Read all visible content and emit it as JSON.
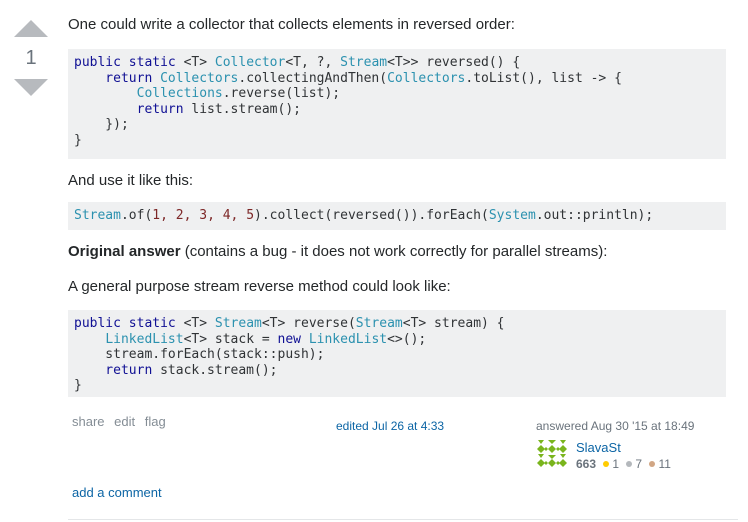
{
  "vote": {
    "count": "1"
  },
  "post": {
    "intro": "One could write a collector that collects elements in reversed order:",
    "usage_intro": "And use it like this:",
    "original_bold": "Original answer",
    "original_rest": " (contains a bug - it does not work correctly for parallel streams):",
    "general_intro": "A general purpose stream reverse method could look like:"
  },
  "code1": {
    "l1a": "public static ",
    "l1b": "<T> ",
    "l1c": "Collector",
    "l1d": "<T, ?, ",
    "l1e": "Stream",
    "l1f": "<T>> reversed() {",
    "l2a": "    return ",
    "l2b": "Collectors",
    "l2c": ".collectingAndThen(",
    "l2d": "Collectors",
    "l2e": ".toList(), list -> {",
    "l3a": "        ",
    "l3b": "Collections",
    "l3c": ".reverse(list);",
    "l4a": "        return ",
    "l4b": "list.stream();",
    "l5": "    });",
    "l6": "}"
  },
  "code2": {
    "a": "Stream",
    "b": ".of(",
    "c": "1, 2, 3, 4, 5",
    "d": ").collect(reversed()).forEach(",
    "e": "System",
    "f": ".out::println);"
  },
  "code3": {
    "l1a": "public static ",
    "l1b": "<T> ",
    "l1c": "Stream",
    "l1d": "<T> reverse(",
    "l1e": "Stream",
    "l1f": "<T> stream) {",
    "l2a": "    ",
    "l2b": "LinkedList",
    "l2c": "<T> stack = ",
    "l2d": "new ",
    "l2e": "LinkedList",
    "l2f": "<>();",
    "l3": "    stream.forEach(stack::push);",
    "l4a": "    return ",
    "l4b": "stack.stream();",
    "l5": "}"
  },
  "menu": {
    "share": "share",
    "edit": "edit",
    "flag": "flag"
  },
  "edited": "edited Jul 26 at 4:33",
  "answered": "answered Aug 30 '15 at 18:49",
  "user": {
    "name": "SlavaSt",
    "reputation": "663",
    "gold": "1",
    "silver": "7",
    "bronze": "11"
  },
  "add_comment": "add a comment",
  "colors": {
    "gold": "#ffcc01",
    "silver": "#b4b8bc",
    "bronze": "#d1a684",
    "link": "#0c65a5"
  }
}
